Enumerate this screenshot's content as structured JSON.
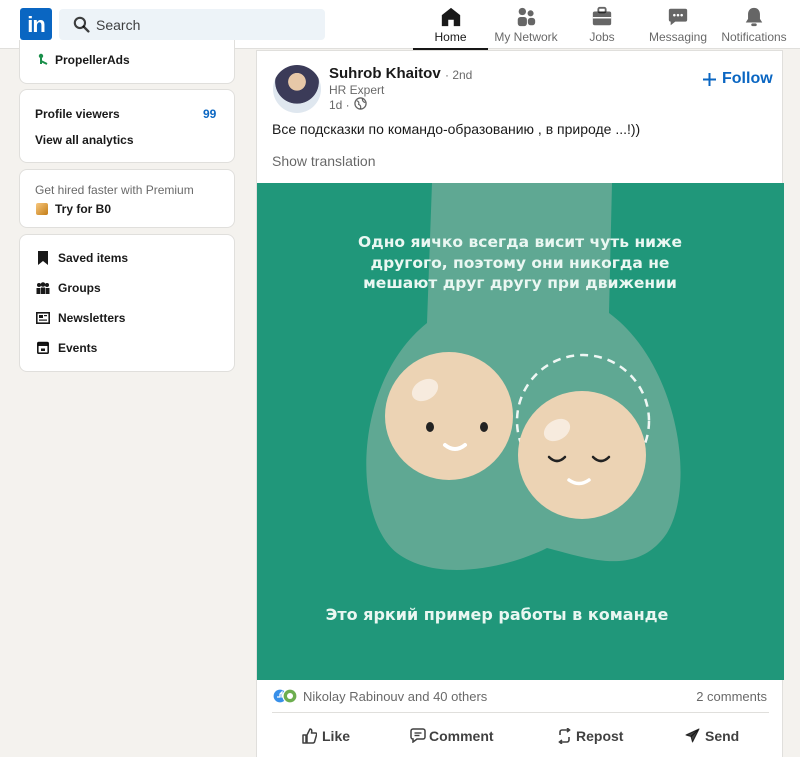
{
  "nav": {
    "logo_text": "in",
    "search_placeholder": "Search",
    "items": [
      {
        "label": "Home",
        "icon": "home-icon",
        "active": true
      },
      {
        "label": "My Network",
        "icon": "network-icon",
        "active": false
      },
      {
        "label": "Jobs",
        "icon": "jobs-icon",
        "active": false
      },
      {
        "label": "Messaging",
        "icon": "messaging-icon",
        "active": false
      },
      {
        "label": "Notifications",
        "icon": "bell-icon",
        "active": false
      }
    ]
  },
  "sidebar": {
    "company": "PropellerAds",
    "profile_viewers_label": "Profile viewers",
    "profile_viewers_count": "99",
    "analytics_link": "View all analytics",
    "premium_text": "Get hired faster with Premium",
    "premium_cta": "Try for B0",
    "links": [
      {
        "label": "Saved items",
        "icon": "bookmark-icon"
      },
      {
        "label": "Groups",
        "icon": "groups-icon"
      },
      {
        "label": "Newsletters",
        "icon": "newsletter-icon"
      },
      {
        "label": "Events",
        "icon": "events-icon"
      }
    ]
  },
  "post": {
    "author": "Suhrob Khaitov",
    "degree": "· 2nd",
    "headline": "HR Expert",
    "time": "1d ·",
    "follow_label": "Follow",
    "text": "Все подсказки по командо-образованию , в природе ...!))",
    "translate_label": "Show translation",
    "image_top_text": [
      "Одно яичко всегда висит чуть ниже",
      "другого, поэтому они никогда не",
      "мешают друг другу при движении"
    ],
    "image_bottom_text": "Это яркий пример работы в команде",
    "reactions_text": "Nikolay Rabinouv and 40 others",
    "comments_text": "2 comments",
    "actions": [
      {
        "label": "Like",
        "icon": "like-icon"
      },
      {
        "label": "Comment",
        "icon": "comment-icon"
      },
      {
        "label": "Repost",
        "icon": "repost-icon"
      },
      {
        "label": "Send",
        "icon": "send-icon"
      }
    ]
  },
  "colors": {
    "brand": "#0a66c2",
    "image_bg": "#20977a",
    "image_shape": "#5fa893",
    "ball": "#ecd3b4"
  }
}
